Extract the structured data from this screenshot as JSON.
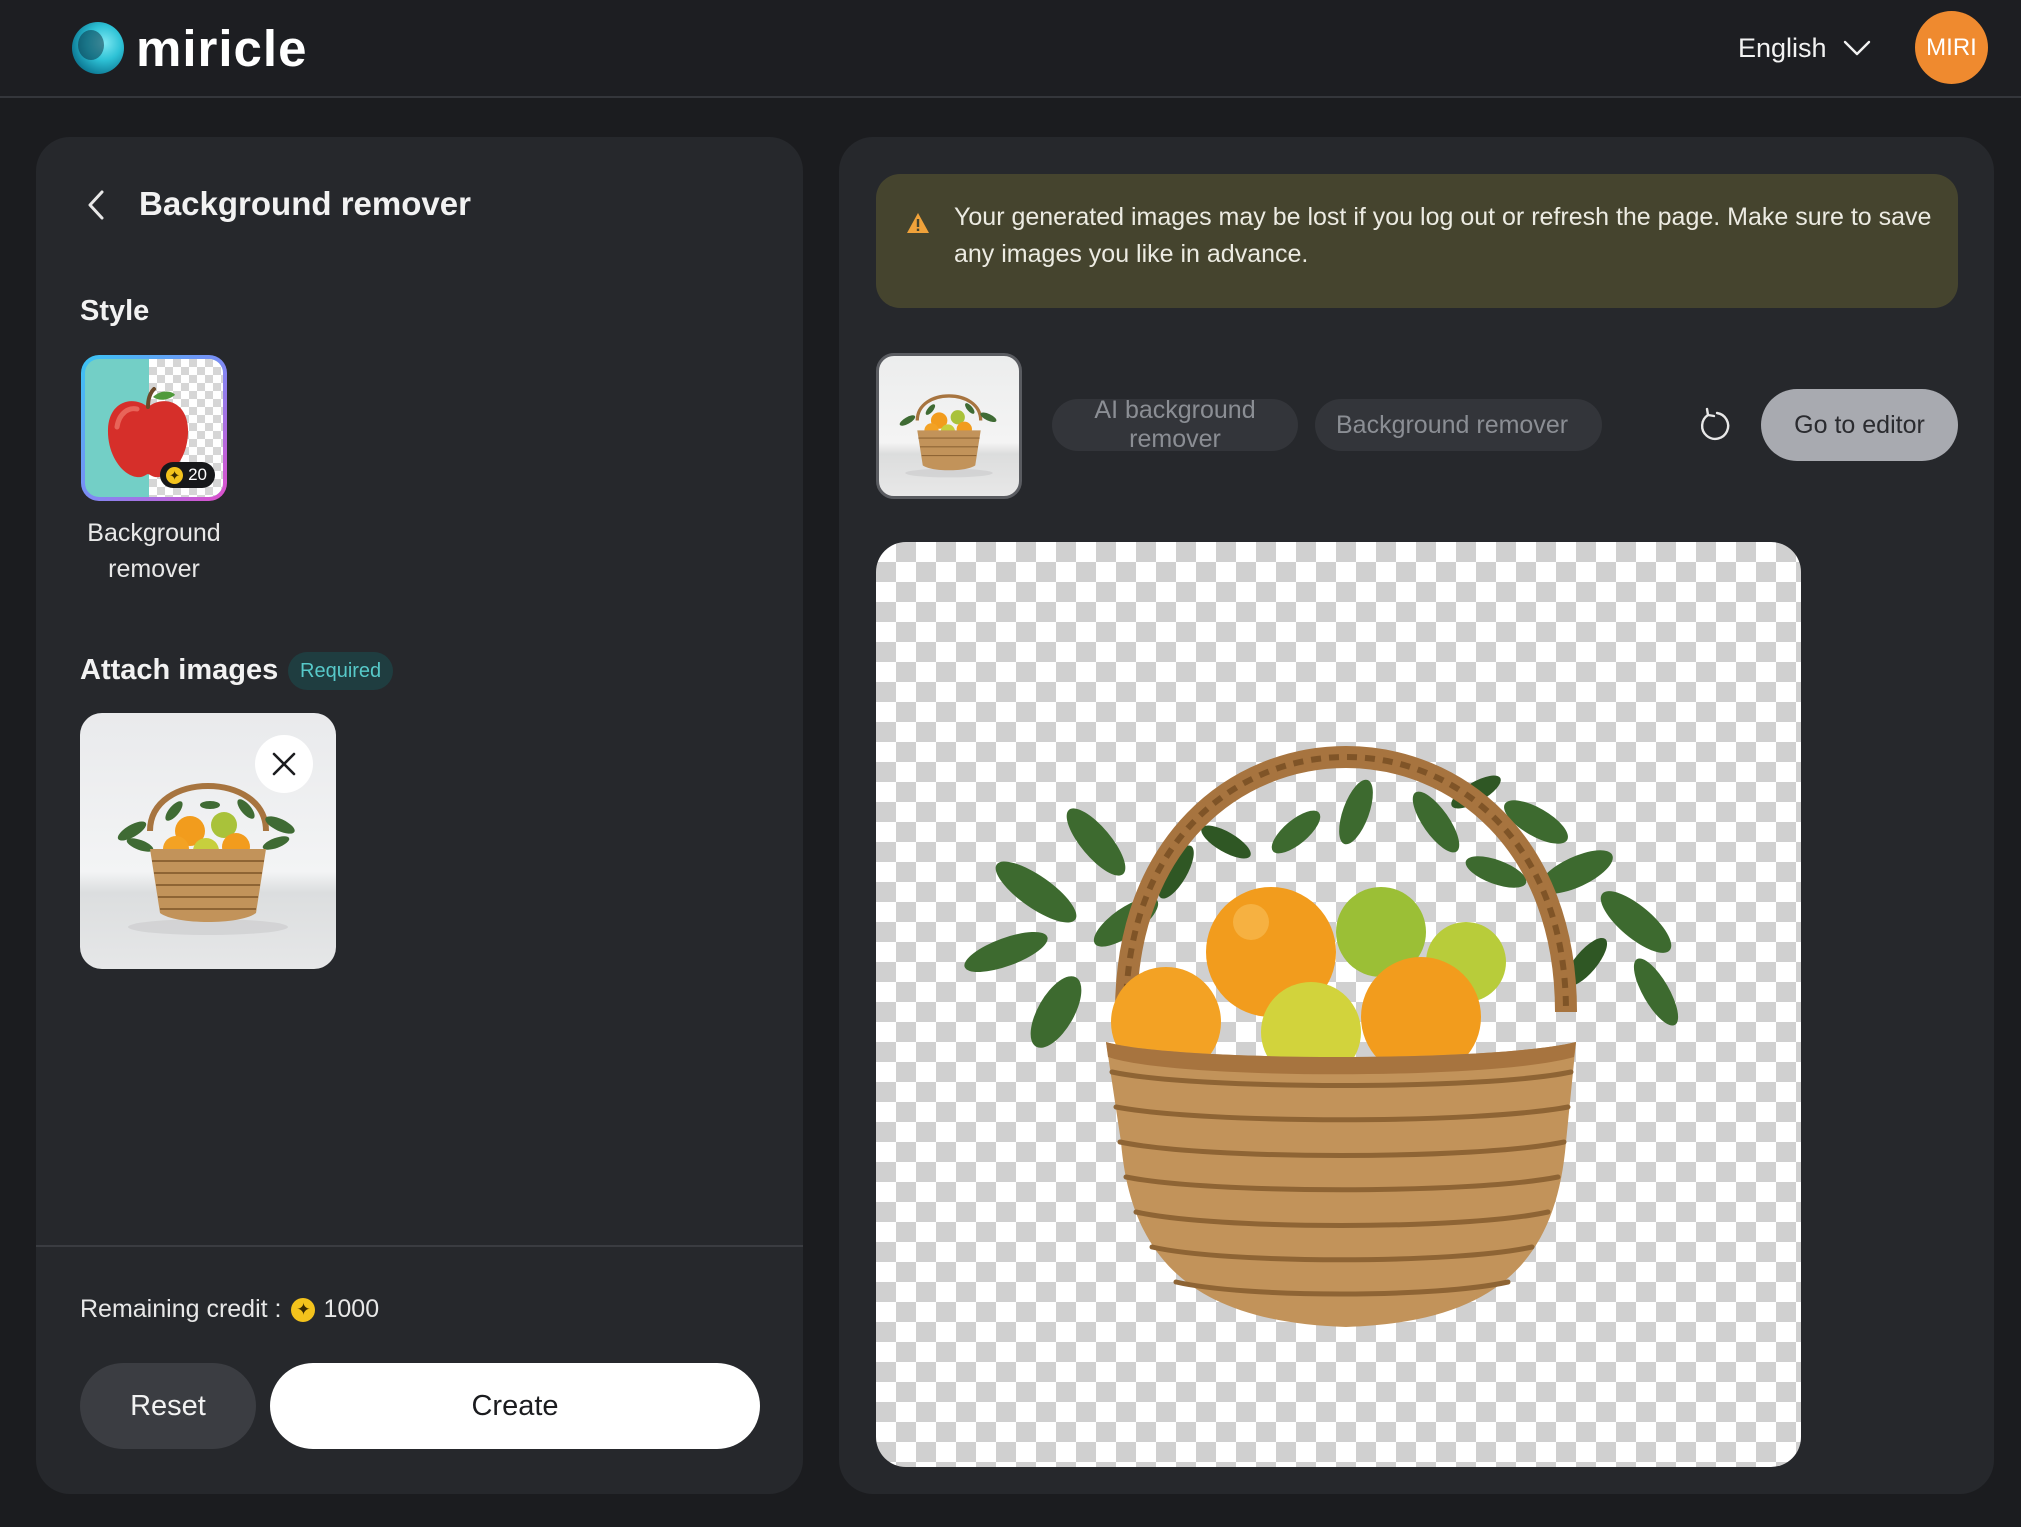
{
  "header": {
    "logo_text": "miricle",
    "language": "English",
    "avatar_initials": "MIRI",
    "avatar_color": "#ef8a2f"
  },
  "left_panel": {
    "title": "Background remover",
    "style_section_label": "Style",
    "style_option": {
      "label": "Background remover",
      "credit_cost": "20",
      "selected": true
    },
    "attach_section_label": "Attach images",
    "required_badge": "Required",
    "remaining_credit_label": "Remaining credit :",
    "remaining_credit_value": "1000",
    "reset_label": "Reset",
    "create_label": "Create"
  },
  "right_panel": {
    "warning_text": "Your generated images may be lost if you log out or refresh the page. Make sure to save any images you like in advance.",
    "tags": [
      "AI background remover",
      "Background remover"
    ],
    "go_to_editor_label": "Go to editor"
  },
  "icons": {
    "logo": "miricle-logo-icon",
    "language_dropdown": "chevron-down-icon",
    "back": "chevron-left-icon",
    "coin": "credit-coin-icon",
    "remove": "close-icon",
    "warning": "warning-triangle-icon",
    "refresh": "refresh-icon"
  },
  "colors": {
    "background": "#1b1c1f",
    "panel": "#26282c",
    "accent_orange": "#ef8a2f",
    "coin_yellow": "#f3c21c",
    "required_teal": "#57c9c9",
    "warning_bg": "#45442e"
  }
}
